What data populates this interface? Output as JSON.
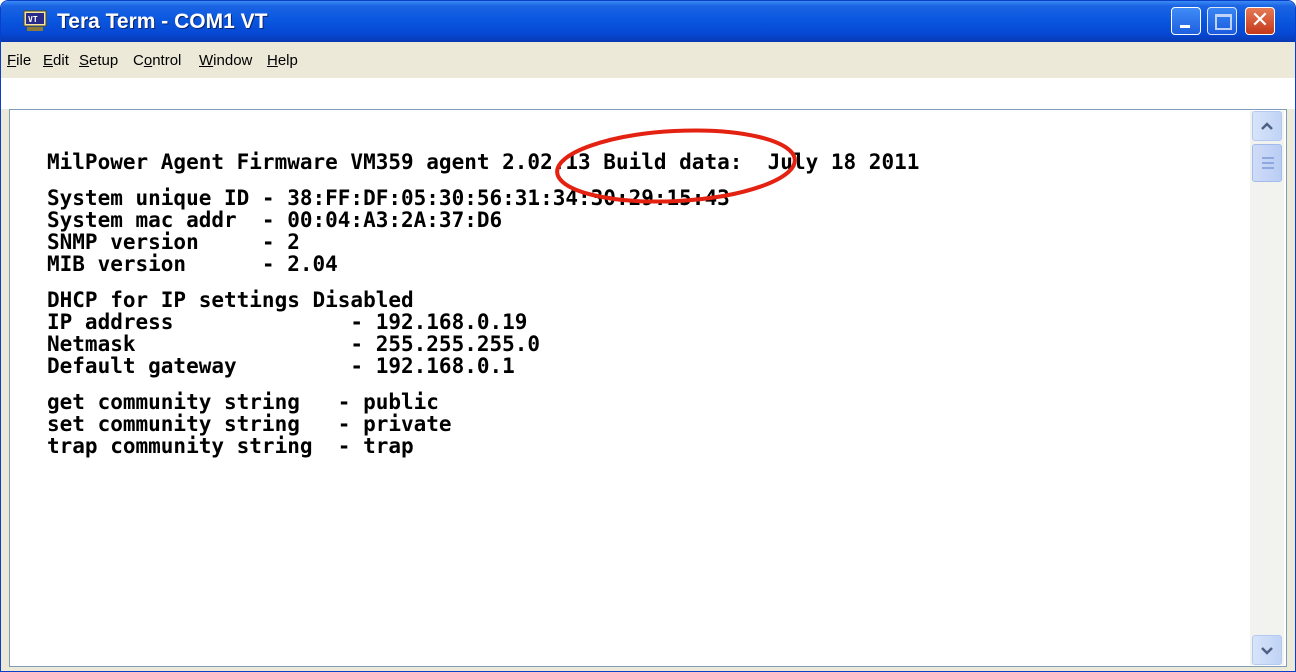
{
  "window": {
    "title": "Tera Term - COM1 VT",
    "icon": "tera-term-app-icon"
  },
  "menu": [
    {
      "label": "File",
      "mnemonic": "F"
    },
    {
      "label": "Edit",
      "mnemonic": "E"
    },
    {
      "label": "Setup",
      "mnemonic": "S"
    },
    {
      "label": "Control",
      "mnemonic": "o"
    },
    {
      "label": "Window",
      "mnemonic": "W"
    },
    {
      "label": "Help",
      "mnemonic": "H"
    }
  ],
  "terminal": {
    "lines": [
      "MilPower Agent Firmware VM359 agent 2.02.13 Build data:  July 18 2011",
      "",
      "System unique ID - 38:FF:DF:05:30:56:31:34:30:29:15:43",
      "System mac addr  - 00:04:A3:2A:37:D6",
      "SNMP version     - 2",
      "MIB version      - 2.04",
      "",
      "DHCP for IP settings Disabled",
      "IP address              - 192.168.0.19",
      "Netmask                 - 255.255.255.0",
      "Default gateway         - 192.168.0.1",
      "",
      "get community string   - public",
      "set community string   - private",
      "trap community string  - trap"
    ]
  },
  "annotation": {
    "shape": "ellipse",
    "color": "#e32212",
    "highlighted_text": "2.02.13"
  },
  "icons": {
    "minimize": "minimize-icon",
    "maximize": "maximize-icon",
    "close": "close-icon",
    "scroll_up": "scroll-up-icon",
    "scroll_down": "scroll-down-icon"
  },
  "colors": {
    "titlebar": "#0a57e0",
    "close_button": "#c4381a",
    "text": "#000000",
    "background": "#ffffff"
  }
}
